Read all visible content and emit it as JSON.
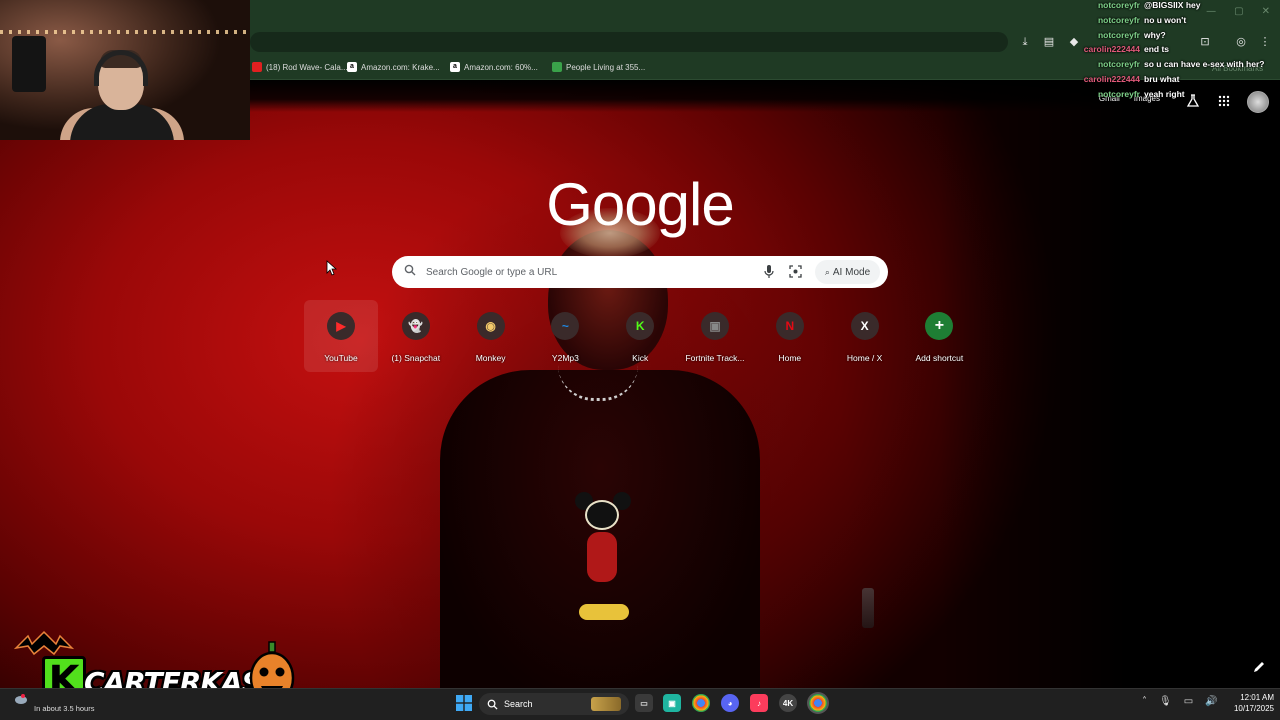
{
  "browser": {
    "bookmarks": [
      {
        "label": "(18) Rod Wave- Cala...",
        "icon": "youtube-favicon",
        "color": "#e02020"
      },
      {
        "label": "Amazon.com: Krake...",
        "icon": "amazon-favicon",
        "color": "#ffffff"
      },
      {
        "label": "Amazon.com: 60%...",
        "icon": "amazon-favicon",
        "color": "#ffffff"
      },
      {
        "label": "People Living at 355...",
        "icon": "generic-favicon",
        "color": "#3aa14a"
      }
    ],
    "overflow_label": "All Bookmarks"
  },
  "ntp": {
    "logo_text": "Google",
    "top_links": [
      "Gmail",
      "Images"
    ],
    "search": {
      "placeholder": "Search Google or type a URL",
      "ai_mode_label": "AI Mode"
    },
    "shortcuts": [
      {
        "label": "YouTube",
        "icon": "youtube-icon",
        "color": "#ff2a2a",
        "glyph": "▶",
        "hover": true
      },
      {
        "label": "(1) Snapchat",
        "icon": "snapchat-icon",
        "color": "#fffc00",
        "glyph": "👻"
      },
      {
        "label": "Monkey",
        "icon": "monkey-icon",
        "color": "#f3c96a",
        "glyph": "◉"
      },
      {
        "label": "Y2Mp3",
        "icon": "y2mp3-icon",
        "color": "#1e88e5",
        "glyph": "~"
      },
      {
        "label": "Kick",
        "icon": "kick-icon",
        "color": "#53fc18",
        "glyph": "K"
      },
      {
        "label": "Fortnite Track...",
        "icon": "fortnite-tracker-icon",
        "color": "#888888",
        "glyph": "▣"
      },
      {
        "label": "Home",
        "icon": "netflix-icon",
        "color": "#e50914",
        "glyph": "N"
      },
      {
        "label": "Home / X",
        "icon": "x-icon",
        "color": "#ffffff",
        "glyph": "X"
      },
      {
        "label": "Add shortcut",
        "icon": "plus-icon",
        "color": "#1e7e34",
        "glyph": "+"
      }
    ]
  },
  "chat": [
    {
      "user": "notcoreyfr",
      "user_color": "#7fd38a",
      "text": "@BIGSIIX hey"
    },
    {
      "user": "notcoreyfr",
      "user_color": "#7fd38a",
      "text": "no u won't"
    },
    {
      "user": "notcoreyfr",
      "user_color": "#7fd38a",
      "text": "why?"
    },
    {
      "user": "carolin222444",
      "user_color": "#e05a7a",
      "text": "end ts"
    },
    {
      "user": "notcoreyfr",
      "user_color": "#7fd38a",
      "text": "so u can have e-sex with her?"
    },
    {
      "user": "carolin222444",
      "user_color": "#e05a7a",
      "text": "bru what"
    },
    {
      "user": "notcoreyfr",
      "user_color": "#7fd38a",
      "text": "yeah right"
    }
  ],
  "brand": {
    "name": "CARTERKASH",
    "letter": "K"
  },
  "taskbar": {
    "weather_text": "In about 3.5 hours",
    "search_label": "Search",
    "time": "12:01 AM",
    "date": "10/17/2025"
  }
}
